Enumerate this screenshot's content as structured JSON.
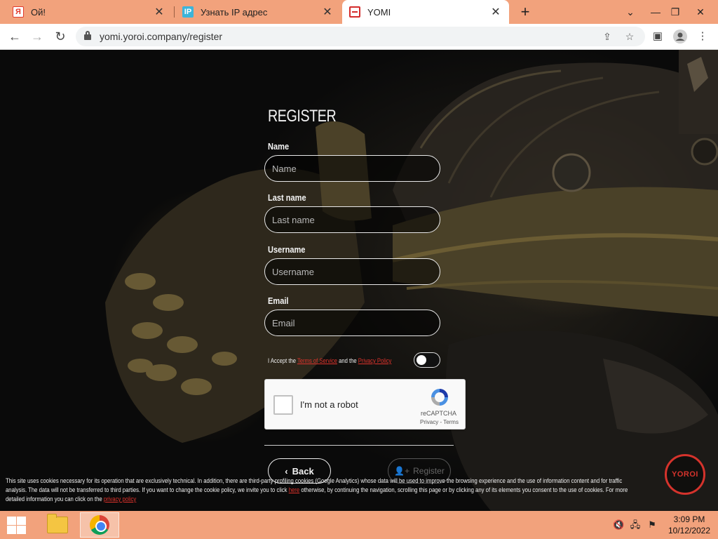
{
  "browser": {
    "tabs": [
      {
        "title": "Ой!",
        "icon": "yandex-icon"
      },
      {
        "title": "Узнать IP адрес",
        "icon": "ip-icon"
      },
      {
        "title": "YOMI",
        "icon": "yomi-icon",
        "active": true
      }
    ],
    "new_tab_symbol": "+",
    "url": "yomi.yoroi.company/register",
    "window_controls": {
      "minimize": "⌄",
      "restore": "❐",
      "close": "✕",
      "tablist": "⌄"
    }
  },
  "form": {
    "title": "REGISTER",
    "fields": [
      {
        "label": "Name",
        "placeholder": "Name",
        "value": ""
      },
      {
        "label": "Last name",
        "placeholder": "Last name",
        "value": ""
      },
      {
        "label": "Username",
        "placeholder": "Username",
        "value": ""
      },
      {
        "label": "Email",
        "placeholder": "Email",
        "value": ""
      }
    ],
    "accept": {
      "prefix": "I Accept the ",
      "terms": "Terms of Service",
      "middle": " and the ",
      "privacy": "Privacy Policy",
      "checked": false
    },
    "captcha": {
      "label": "I'm not a robot",
      "brand": "reCAPTCHA",
      "links": "Privacy - Terms"
    },
    "back_label": "Back",
    "register_label": "Register"
  },
  "logo_text": "YOROI",
  "cookie_notice": {
    "text_before": "This site uses cookies necessary for its operation that are exclusively technical. In addition, there are third-party profiling cookies (Google Analytics) whose data will be used to improve the browsing experience and the use of information content and for traffic analysis. The data will not be transferred to third parties. If you want to change the cookie policy, we invite you to click ",
    "link1": "here",
    "text_middle": " otherwise, by continuing the navigation, scrolling this page or by clicking any of its elements you consent to the use of cookies. For more detailed information you can click on the ",
    "link2": "privacy policy"
  },
  "taskbar": {
    "time": "3:09 PM",
    "date": "10/12/2022"
  },
  "colors": {
    "accent_red": "#d5332c",
    "chrome_frame": "#f2a27c",
    "page_bg": "#0b0b0b"
  }
}
